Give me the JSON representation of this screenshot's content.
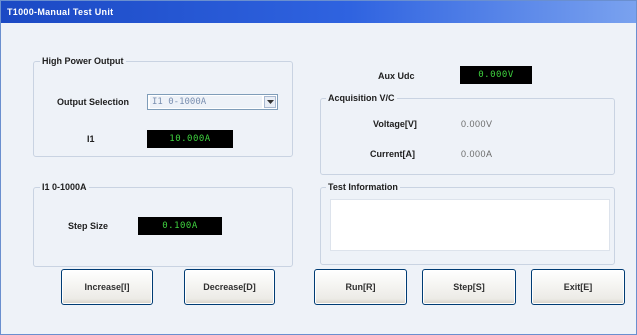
{
  "window": {
    "title": "T1000-Manual Test Unit"
  },
  "high_power_output": {
    "title": "High Power Output",
    "selection_label": "Output Selection",
    "selection_value": "I1  0-1000A",
    "i1_label": "I1",
    "i1_value": "10.000A"
  },
  "range_group": {
    "title": "I1  0-1000A",
    "step_label": "Step Size",
    "step_value": "0.100A"
  },
  "aux": {
    "label": "Aux Udc",
    "value": "0.000V"
  },
  "acquisition": {
    "title": "Acquisition V/C",
    "voltage_label": "Voltage[V]",
    "voltage_value": "0.000V",
    "current_label": "Current[A]",
    "current_value": "0.000A"
  },
  "test_info": {
    "title": "Test Information",
    "text": ""
  },
  "buttons": {
    "increase": "Increase[I]",
    "decrease": "Decrease[D]",
    "run": "Run[R]",
    "step": "Step[S]",
    "exit": "Exit[E]"
  }
}
